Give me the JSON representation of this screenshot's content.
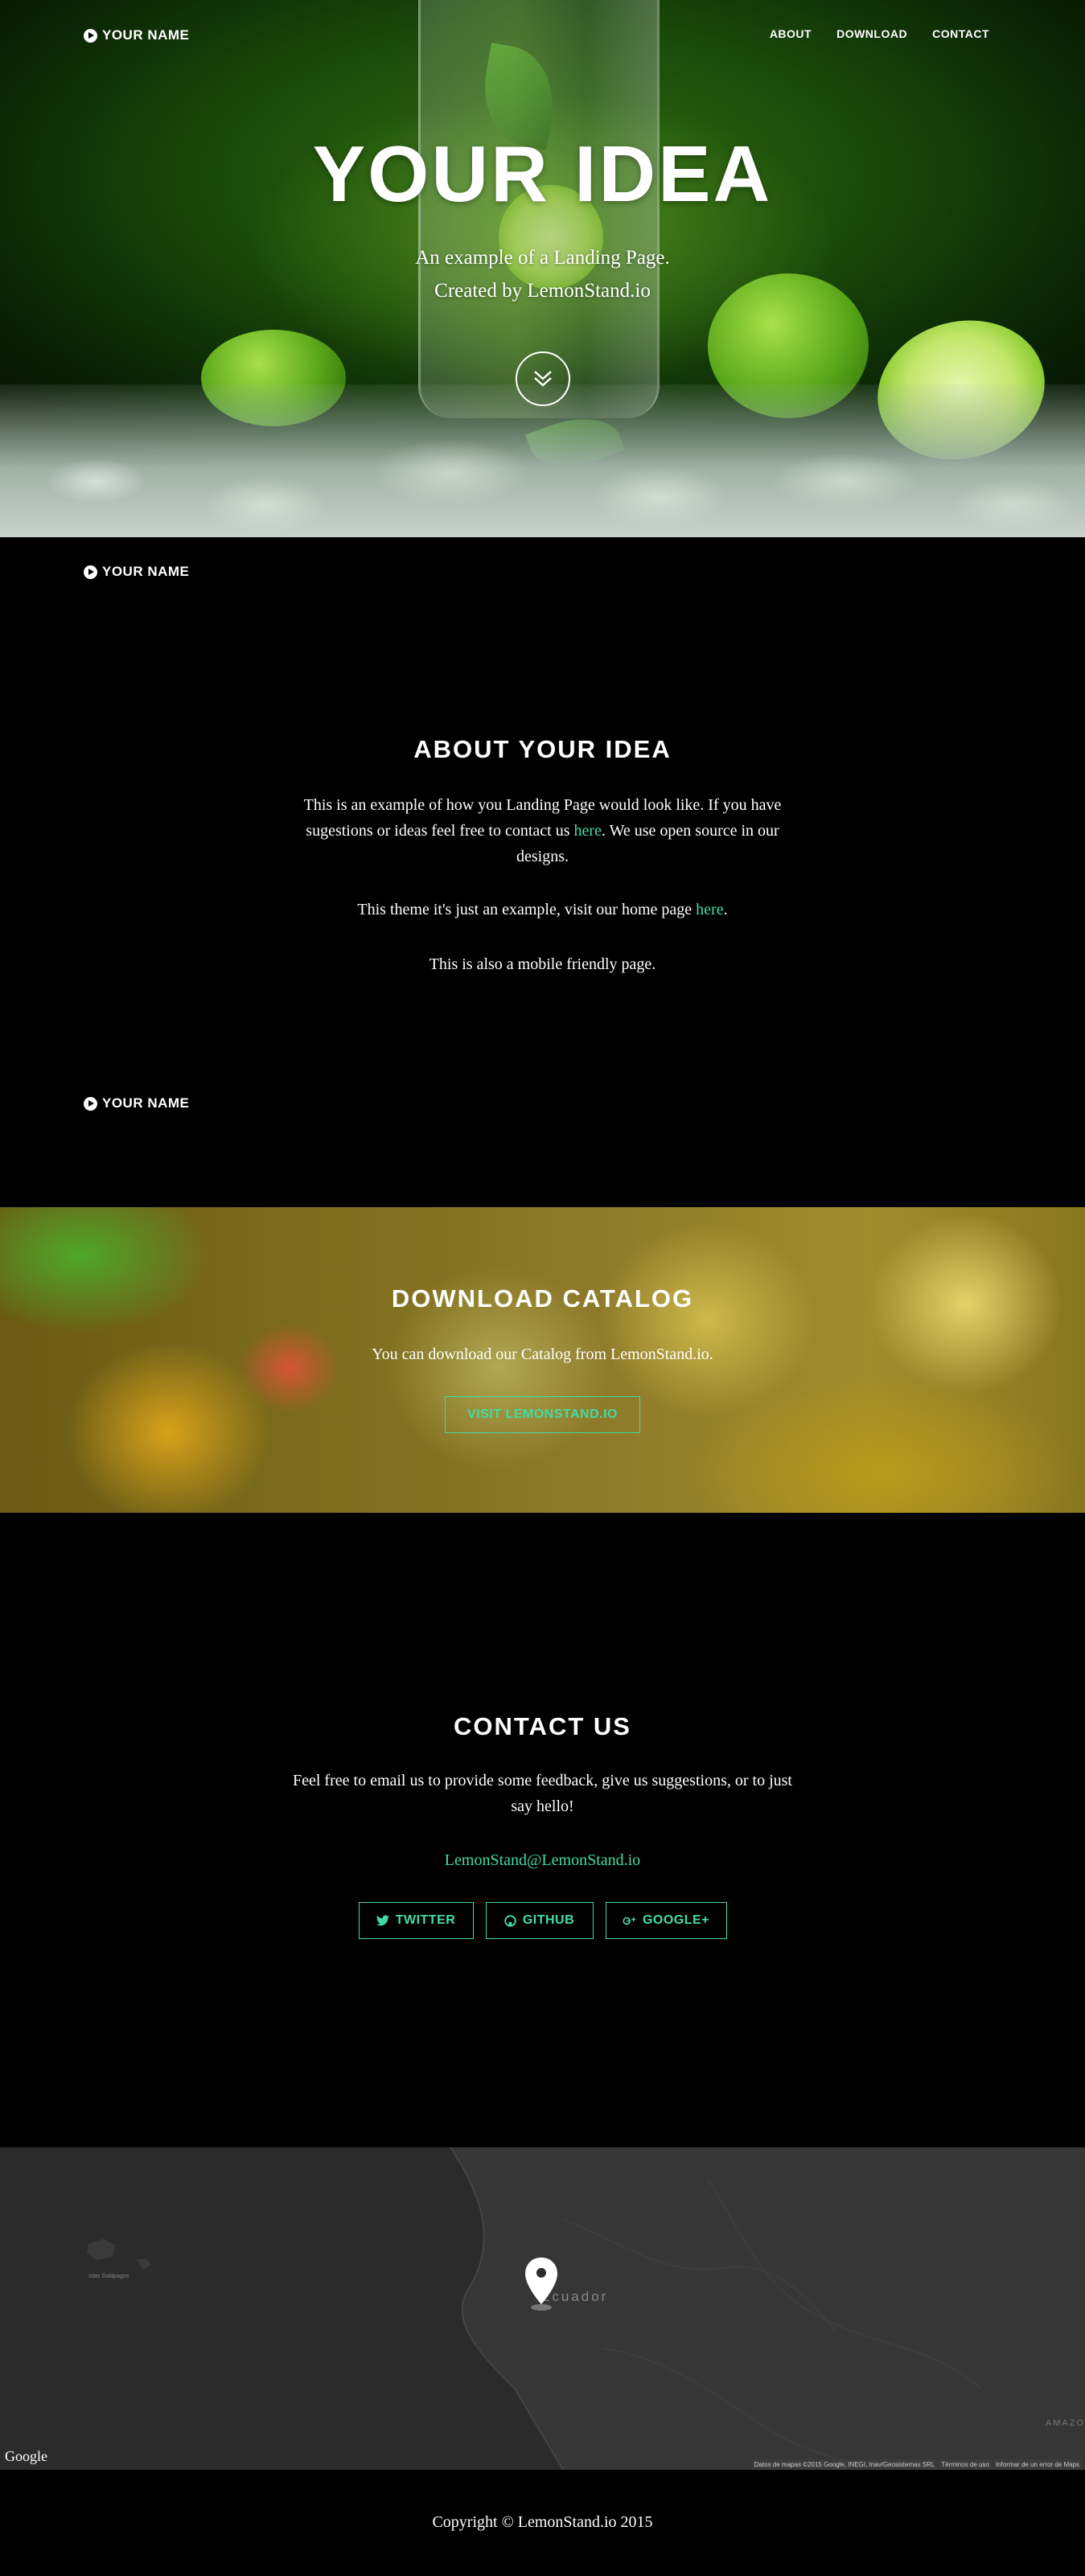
{
  "brand": {
    "name": "YOUR NAME"
  },
  "nav": {
    "links": [
      "ABOUT",
      "DOWNLOAD",
      "CONTACT"
    ]
  },
  "hero": {
    "title": "YOUR IDEA",
    "subtitle_line1": "An example of a Landing Page.",
    "subtitle_line2": "Created by LemonStand.io",
    "scroll_icon": "double-chevron-down-icon"
  },
  "about": {
    "heading": "ABOUT YOUR IDEA",
    "p1_part1": "This is an example of how you Landing Page would look like. If you have",
    "p1_part2": "sugestions or ideas feel free to contact us ",
    "p1_link": "here",
    "p1_part3": ". We use open source in our",
    "p1_part4": "designs.",
    "p2_text": "This theme it's just an example, visit our home page ",
    "p2_link": "here",
    "p2_end": ".",
    "p3": "This is also a mobile friendly page."
  },
  "download": {
    "heading": "DOWNLOAD CATALOG",
    "text": "You can download our Catalog from LemonStand.io.",
    "button": "VISIT LEMONSTAND.IO"
  },
  "contact": {
    "heading": "CONTACT US",
    "line1": "Feel free to email us to provide some feedback, give us suggestions, or to just",
    "line2": "say hello!",
    "email": "LemonStand@LemonStand.io",
    "buttons": [
      {
        "label": "TWITTER",
        "icon": "twitter-icon"
      },
      {
        "label": "GITHUB",
        "icon": "github-icon"
      },
      {
        "label": "GOOGLE+",
        "icon": "google-plus-icon"
      }
    ]
  },
  "map": {
    "country_label": "Ecuador",
    "island_label": "Islas Galápagos",
    "region_label": "AMAZO",
    "google_logo": "Google",
    "attribution": [
      "Datos de mapas ©2015 Google, INEGI, Inav/Geosistemas SRL",
      "Términos de uso",
      "Informar de un error de Maps"
    ]
  },
  "footer": {
    "copyright": "Copyright © LemonStand.io 2015"
  },
  "colors": {
    "accent": "#42dca3",
    "background": "#000000"
  }
}
